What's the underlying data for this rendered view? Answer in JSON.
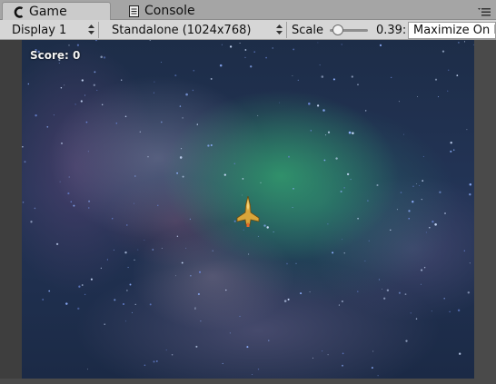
{
  "tabs": [
    {
      "label": "Game",
      "icon": "unity-game-icon",
      "active": true
    },
    {
      "label": "Console",
      "icon": "console-icon",
      "active": false
    }
  ],
  "toolbar": {
    "display": {
      "value": "Display 1"
    },
    "resolution": {
      "value": "Standalone (1024x768)"
    },
    "scale": {
      "label": "Scale",
      "value": "0.39:",
      "level": 0.1
    },
    "maximize_toggle": {
      "label": "Maximize On P"
    }
  },
  "game": {
    "score_text": "Score: 0"
  },
  "colors": {
    "tab_active_bg": "#cbcbcb",
    "toolbar_bg": "#d6d6d6",
    "ship_gold": "#d9a53a",
    "nebula_green": "#34a870"
  }
}
